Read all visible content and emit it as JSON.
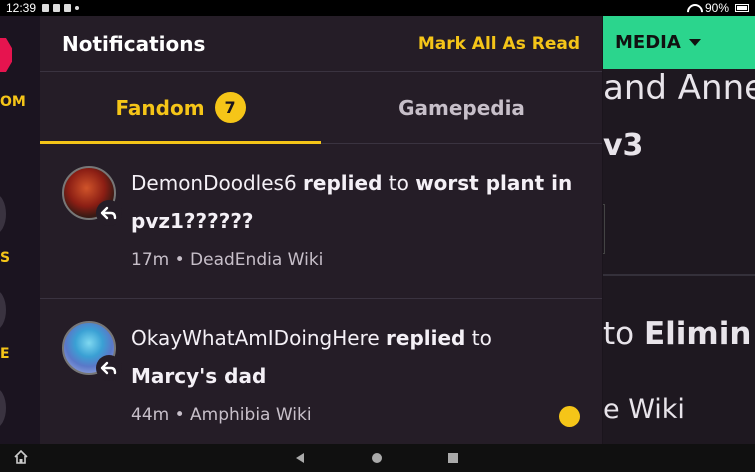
{
  "status_bar": {
    "time": "12:39",
    "battery": "90%"
  },
  "left_rail": {
    "label1": "OM",
    "label2": "S",
    "label3": "E"
  },
  "background_page": {
    "media_label": "MEDIA",
    "line1": "and Anne",
    "line2": "v3",
    "line3_prefix": "to ",
    "line3_bold": "Elimin",
    "line4": "e Wiki"
  },
  "panel": {
    "title": "Notifications",
    "mark_all_read": "Mark All As Read",
    "tabs": [
      {
        "label": "Fandom",
        "badge": "7",
        "active": true
      },
      {
        "label": "Gamepedia",
        "active": false
      }
    ],
    "notifications": [
      {
        "user": "DemonDoodles6",
        "action": "replied",
        "connector": "to",
        "target": "worst plant in pvz1??????",
        "time": "17m",
        "separator": "•",
        "wiki": "DeadEndia Wiki",
        "unread": false
      },
      {
        "user": "OkayWhatAmIDoingHere",
        "action": "replied",
        "connector": "to",
        "target": "Marcy's dad",
        "time": "44m",
        "separator": "•",
        "wiki": "Amphibia Wiki",
        "unread": true
      }
    ]
  },
  "colors": {
    "accent": "#f5c518",
    "media": "#2bd58d",
    "panel_bg": "#251d27",
    "logo": "#e6144f"
  },
  "icons": {
    "reply": "reply-arrow-icon",
    "home": "home-icon",
    "back": "back-icon",
    "recents": "recents-icon"
  }
}
